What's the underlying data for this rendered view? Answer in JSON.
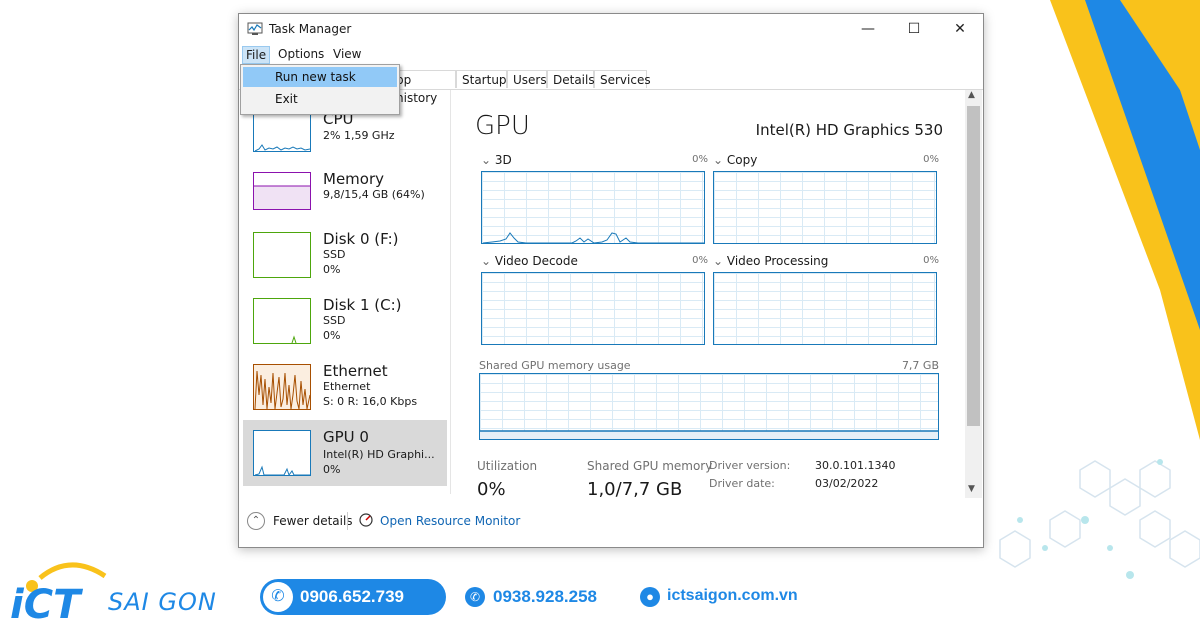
{
  "window": {
    "title": "Task Manager"
  },
  "menubar": {
    "file": "File",
    "options": "Options",
    "view": "View"
  },
  "file_menu": {
    "run_new_task": "Run new task",
    "exit": "Exit"
  },
  "tabs": [
    "pp history",
    "Startup",
    "Users",
    "Details",
    "Services"
  ],
  "sidebar": {
    "items": [
      {
        "title": "CPU",
        "line1": "2%  1,59 GHz",
        "line2": ""
      },
      {
        "title": "Memory",
        "line1": "9,8/15,4 GB (64%)",
        "line2": ""
      },
      {
        "title": "Disk 0 (F:)",
        "line1": "SSD",
        "line2": "0%"
      },
      {
        "title": "Disk 1 (C:)",
        "line1": "SSD",
        "line2": "0%"
      },
      {
        "title": "Ethernet",
        "line1": "Ethernet",
        "line2": "S: 0  R: 16,0 Kbps"
      },
      {
        "title": "GPU 0",
        "line1": "Intel(R) HD Graphi...",
        "line2": "0%"
      }
    ]
  },
  "main": {
    "title": "GPU",
    "gpu_name": "Intel(R) HD Graphics 530",
    "engines": [
      {
        "label": "3D",
        "pct": "0%"
      },
      {
        "label": "Copy",
        "pct": "0%"
      },
      {
        "label": "Video Decode",
        "pct": "0%"
      },
      {
        "label": "Video Processing",
        "pct": "0%"
      }
    ],
    "shared_label": "Shared GPU memory usage",
    "shared_max": "7,7 GB",
    "utilization_label": "Utilization",
    "utilization_value": "0%",
    "shared_mem_label": "Shared GPU memory",
    "shared_mem_value": "1,0/7,7 GB",
    "driver": [
      {
        "k": "Driver version:",
        "v": "30.0.101.1340"
      },
      {
        "k": "Driver date:",
        "v": "03/02/2022"
      }
    ]
  },
  "bottom": {
    "fewer_details": "Fewer details",
    "open_monitor": "Open Resource Monitor"
  },
  "footer": {
    "brand_icon_text": "iCT",
    "brand_text": "SAI GON",
    "phone1": "0906.652.739",
    "phone2": "0938.928.258",
    "website": "ictsaigon.com.vn"
  },
  "colors": {
    "accent": "#1979b9",
    "memory": "#8b12ae",
    "disk": "#4da60c",
    "ethernet": "#a74f01",
    "brand": "#1e88e5",
    "yellow": "#f9c21b"
  }
}
